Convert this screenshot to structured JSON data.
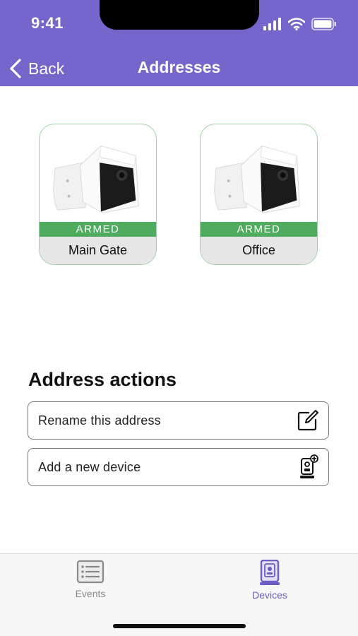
{
  "status_bar": {
    "time": "9:41"
  },
  "nav": {
    "back_label": "Back",
    "title": "Addresses"
  },
  "devices": [
    {
      "status": "ARMED",
      "name": "Main Gate"
    },
    {
      "status": "ARMED",
      "name": "Office"
    }
  ],
  "actions": {
    "section_title": "Address actions",
    "items": [
      {
        "label": "Rename this address",
        "icon": "edit-icon"
      },
      {
        "label": "Add a new device",
        "icon": "add-device-icon"
      }
    ]
  },
  "tabbar": {
    "tabs": [
      {
        "label": "Events",
        "icon": "events-list-icon",
        "active": false
      },
      {
        "label": "Devices",
        "icon": "devices-icon",
        "active": true
      }
    ]
  },
  "colors": {
    "header": "#7566cb",
    "armed": "#4fab5e",
    "active_tab": "#6c5cc4",
    "inactive_tab": "#8a8a8a"
  }
}
